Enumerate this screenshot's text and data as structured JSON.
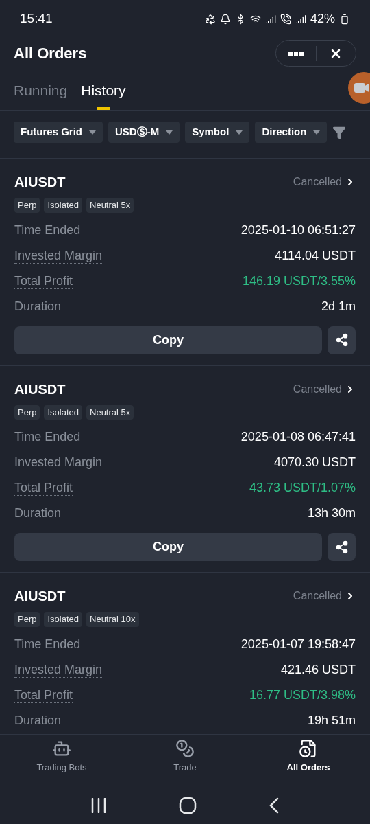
{
  "status_bar": {
    "time": "15:41",
    "battery": "42%"
  },
  "header": {
    "title": "All Orders"
  },
  "tabs": [
    {
      "label": "Running",
      "selected": false
    },
    {
      "label": "History",
      "selected": true
    }
  ],
  "filters": [
    "Futures Grid",
    "USDⓈ-M",
    "Symbol",
    "Direction"
  ],
  "orders": [
    {
      "symbol": "AIUSDT",
      "status": "Cancelled",
      "tags": [
        "Perp",
        "Isolated",
        "Neutral 5x"
      ],
      "rows": [
        {
          "label": "Time Ended",
          "value": "2025-01-10 06:51:27",
          "hint": false,
          "positive": false
        },
        {
          "label": "Invested Margin",
          "value": "4114.04 USDT",
          "hint": true,
          "positive": false
        },
        {
          "label": "Total Profit",
          "value": "146.19 USDT/3.55%",
          "hint": true,
          "positive": true
        },
        {
          "label": "Duration",
          "value": "2d 1m",
          "hint": false,
          "positive": false
        }
      ],
      "button": "Copy"
    },
    {
      "symbol": "AIUSDT",
      "status": "Cancelled",
      "tags": [
        "Perp",
        "Isolated",
        "Neutral 5x"
      ],
      "rows": [
        {
          "label": "Time Ended",
          "value": "2025-01-08 06:47:41",
          "hint": false,
          "positive": false
        },
        {
          "label": "Invested Margin",
          "value": "4070.30 USDT",
          "hint": true,
          "positive": false
        },
        {
          "label": "Total Profit",
          "value": "43.73 USDT/1.07%",
          "hint": true,
          "positive": true
        },
        {
          "label": "Duration",
          "value": "13h 30m",
          "hint": false,
          "positive": false
        }
      ],
      "button": "Copy"
    },
    {
      "symbol": "AIUSDT",
      "status": "Cancelled",
      "tags": [
        "Perp",
        "Isolated",
        "Neutral 10x"
      ],
      "rows": [
        {
          "label": "Time Ended",
          "value": "2025-01-07 19:58:47",
          "hint": false,
          "positive": false
        },
        {
          "label": "Invested Margin",
          "value": "421.46 USDT",
          "hint": true,
          "positive": false
        },
        {
          "label": "Total Profit",
          "value": "16.77 USDT/3.98%",
          "hint": true,
          "positive": true
        },
        {
          "label": "Duration",
          "value": "19h 51m",
          "hint": false,
          "positive": false
        }
      ]
    }
  ],
  "bottom_nav": [
    {
      "label": "Trading Bots",
      "kind": "bots",
      "selected": false
    },
    {
      "label": "Trade",
      "kind": "trade",
      "selected": false
    },
    {
      "label": "All Orders",
      "kind": "orders",
      "selected": true
    }
  ]
}
